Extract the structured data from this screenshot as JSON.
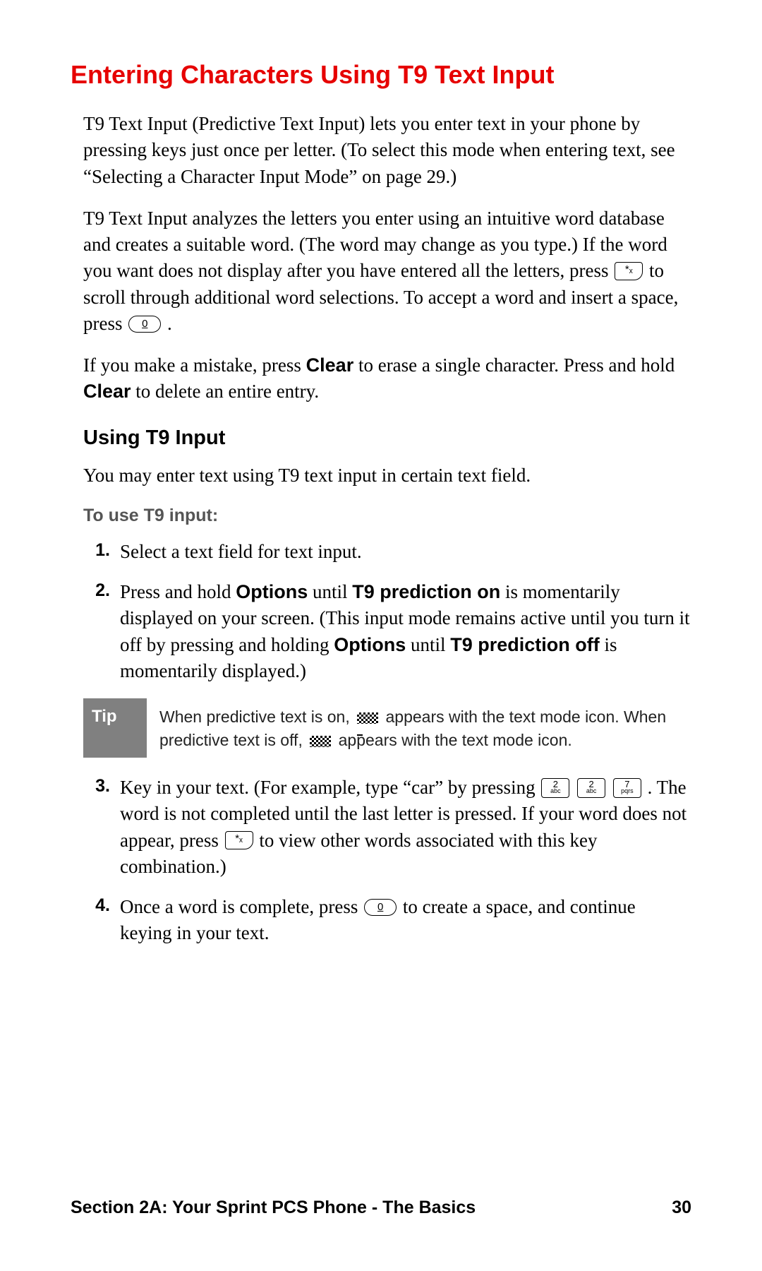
{
  "heading": "Entering Characters Using T9 Text Input",
  "para1": "T9 Text Input (Predictive Text Input) lets you enter text in your phone by pressing keys just once per letter. (To select this mode when entering text, see “Selecting a Character Input Mode” on page 29.)",
  "para2a": "T9 Text Input analyzes the letters you enter using an intuitive word database and creates a suitable word. (The word may change as you type.) If the word you want does not display after you have entered all the letters, press ",
  "para2b": " to scroll through additional word selections. To accept a word and insert a space, press ",
  "para2c": ".",
  "para3a": "If you make a mistake, press ",
  "para3b": " to erase a single character. Press and hold ",
  "para3c": " to delete an entire entry.",
  "clear": "Clear",
  "subheading": "Using T9 Input",
  "para4": "You may enter text using T9 text input in certain text field.",
  "instrHeading": "To use T9 input:",
  "steps": {
    "n1": "1.",
    "s1": "Select a text field for text input.",
    "n2": "2.",
    "s2a": "Press and hold ",
    "s2b": " until ",
    "s2c": " is momentarily displayed on your screen. (This input mode remains active until you turn it off by pressing and holding ",
    "s2d": " until ",
    "s2e": " is momentarily displayed.)",
    "options": "Options",
    "t9on": "T9 prediction on",
    "t9off": "T9 prediction off",
    "n3": "3.",
    "s3a": "Key in your text. (For example, type “car” by pressing ",
    "s3b": ". The word is not completed until the last letter is pressed. If your word does not appear, press ",
    "s3c": " to view other words associated with this key combination.)",
    "n4": "4.",
    "s4a": "Once a word is complete, press ",
    "s4b": " to create a space, and continue keying in your text."
  },
  "tipLabel": "Tip",
  "tipA": "When predictive text is on, ",
  "tipB": " appears with the text mode icon. When predictive text is off, ",
  "tipC": " appears with the text mode icon.",
  "keys": {
    "star": "*ₓ",
    "zero": "0",
    "k2n": "2",
    "k2l": "abc",
    "k7n": "7",
    "k7l": "pqrs"
  },
  "footerSection": "Section 2A: Your Sprint PCS Phone - The Basics",
  "footerPage": "30"
}
